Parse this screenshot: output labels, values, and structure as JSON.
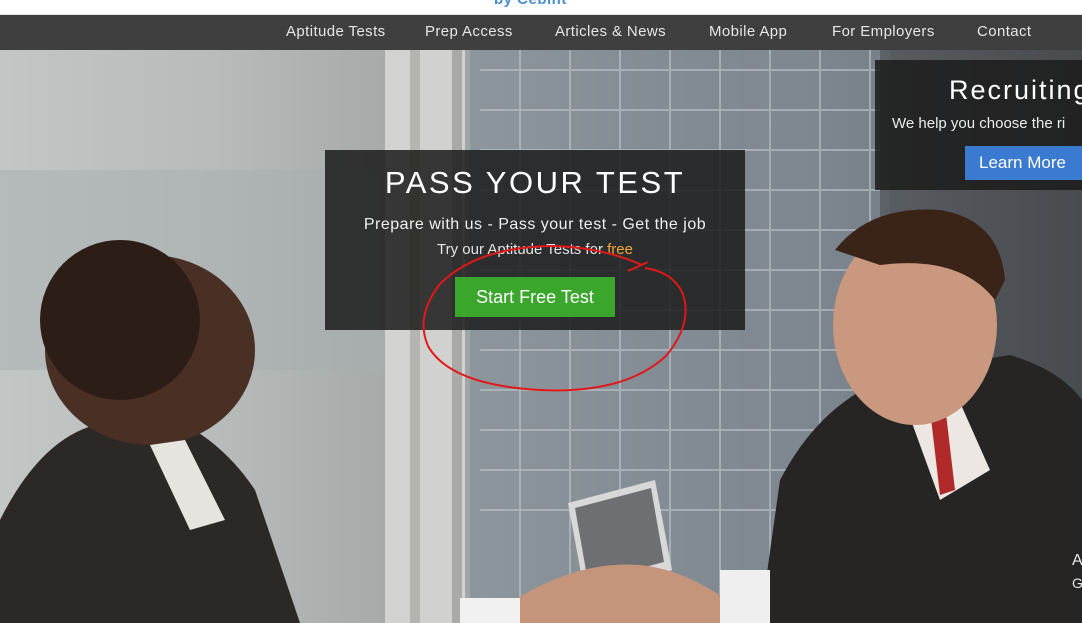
{
  "header": {
    "logo_fragment": "by Cebint"
  },
  "nav": {
    "items": [
      "Aptitude Tests",
      "Prep Access",
      "Articles & News",
      "Mobile App",
      "For Employers",
      "Contact"
    ]
  },
  "hero": {
    "title": "PASS YOUR TEST",
    "subtitle": "Prepare with us - Pass your test - Get the job",
    "try_prefix": "Try our Aptitude Tests for ",
    "try_highlight": "free",
    "cta_label": "Start Free Test"
  },
  "recruit": {
    "title": "Recruiting",
    "text": "We help you choose the ri",
    "button_label": "Learn More"
  },
  "edge": {
    "line1": "A",
    "line2": "G"
  },
  "colors": {
    "navbar": "#3f3f3f",
    "cta_green": "#3aa62c",
    "learn_blue": "#3a7ad0",
    "free_orange": "#f0a63a",
    "annotation_red": "#e01818"
  }
}
